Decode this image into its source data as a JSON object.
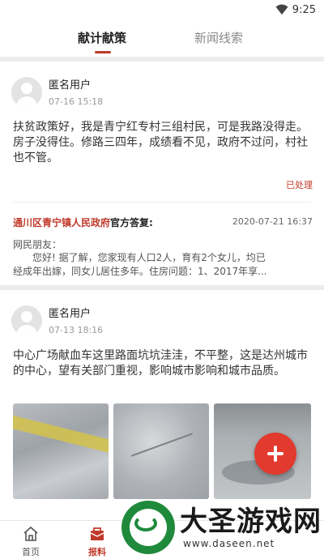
{
  "status_bar": {
    "time": "9:25"
  },
  "tabs": [
    {
      "label": "献计献策",
      "active": true
    },
    {
      "label": "新闻线索",
      "active": false
    }
  ],
  "posts": [
    {
      "username": "匿名用户",
      "time": "07-16  15:18",
      "content": "扶贫政策好，我是青宁红专村三组村民，可是我路没得走。房子没得住。修路三四年，成绩看不见，政府不过问，村社也不管。",
      "status": "已处理",
      "reply": {
        "org": "通川区青宁镇人民政府",
        "label": "官方答复:",
        "date": "2020-07-21 16:37",
        "greeting": "网民朋友：",
        "line1": "您好! 据了解，您家现有人口2人，育有2个女儿，均已",
        "line2": "经成年出嫁，同女儿居住多年。住房问题：1、2017年享..."
      }
    },
    {
      "username": "匿名用户",
      "time": "07-13  18:16",
      "content": "中心广场献血车这里路面坑坑洼洼，不平整，这是达州城市的中心，望有关部门重视，影响城市影响和城市品质。"
    }
  ],
  "nav": [
    {
      "label": "首页",
      "icon": "home-icon"
    },
    {
      "label": "报料",
      "icon": "report-icon"
    }
  ],
  "watermark": {
    "title": "大圣游戏网",
    "url": "www.daseen.net"
  },
  "colors": {
    "accent": "#c0392b",
    "fab": "#e23a2e"
  }
}
